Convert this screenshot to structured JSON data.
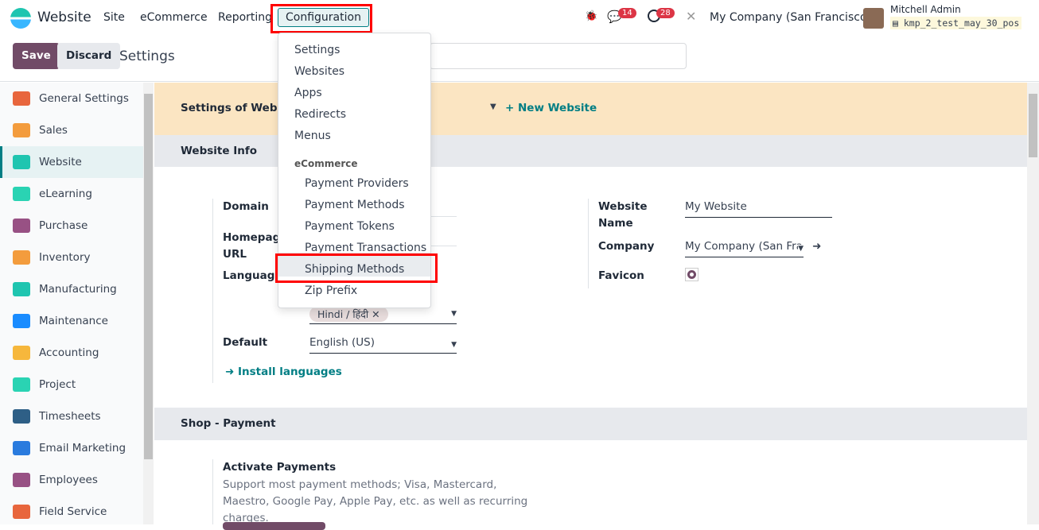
{
  "navbar": {
    "app_name": "Website",
    "menus": [
      "Site",
      "eCommerce",
      "Reporting",
      "Configuration"
    ],
    "messages_count": "14",
    "activities_count": "28",
    "company": "My Company (San Francisco)",
    "user_name": "Mitchell Admin",
    "database": "kmp_2_test_may_30_pos"
  },
  "control_panel": {
    "save": "Save",
    "discard": "Discard",
    "title": "Settings"
  },
  "sidebar": {
    "items": [
      {
        "label": "General Settings",
        "color": "#e8663d"
      },
      {
        "label": "Sales",
        "color": "#f39c3d"
      },
      {
        "label": "Website",
        "color": "#1fc5b0"
      },
      {
        "label": "eLearning",
        "color": "#2ad3b3"
      },
      {
        "label": "Purchase",
        "color": "#985184"
      },
      {
        "label": "Inventory",
        "color": "#f39c3d"
      },
      {
        "label": "Manufacturing",
        "color": "#1fc5b0"
      },
      {
        "label": "Maintenance",
        "color": "#1a8cff"
      },
      {
        "label": "Accounting",
        "color": "#f6b73c"
      },
      {
        "label": "Project",
        "color": "#2ad3b3"
      },
      {
        "label": "Timesheets",
        "color": "#2e5f86"
      },
      {
        "label": "Email Marketing",
        "color": "#2a7bde"
      },
      {
        "label": "Employees",
        "color": "#985184"
      },
      {
        "label": "Field Service",
        "color": "#e8663d"
      }
    ]
  },
  "dropdown": {
    "items": [
      "Settings",
      "Websites",
      "Apps",
      "Redirects",
      "Menus"
    ],
    "section": "eCommerce",
    "ecommerce_items": [
      "Payment Providers",
      "Payment Methods",
      "Payment Tokens",
      "Payment Transactions",
      "Shipping Methods",
      "Zip Prefix"
    ],
    "highlighted": "Shipping Methods"
  },
  "content": {
    "settings_of_website": "Settings of Website",
    "new_website": "+ New Website",
    "website_info": "Website Info",
    "domain_label": "Domain",
    "homepage_label": "Homepage URL",
    "languages_label": "Languages",
    "language_tag": "Hindi / हिंदी",
    "default_label": "Default",
    "default_value": "English (US)",
    "install_languages": "Install languages",
    "website_name_label": "Website Name",
    "website_name": "My Website",
    "company_label": "Company",
    "company_value": "My Company (San Fran",
    "favicon_label": "Favicon",
    "shop_payment": "Shop - Payment",
    "activate_payments": "Activate Payments",
    "activate_payments_desc": "Support most payment methods; Visa, Mastercard, Maestro, Google Pay, Apple Pay, etc. as well as recurring charges."
  },
  "colors": {
    "primary": "#714b67",
    "accent": "#017e84",
    "highlight_box": "#ff0000",
    "settings_band": "#fbe5c2"
  }
}
